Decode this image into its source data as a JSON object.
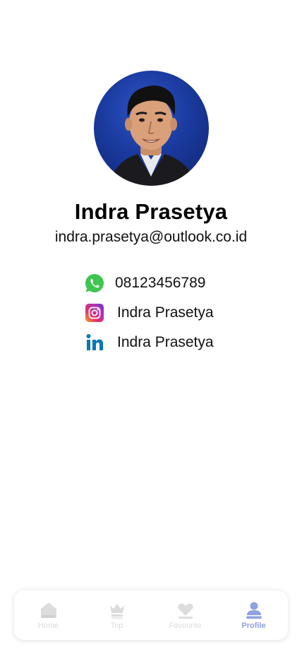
{
  "profile": {
    "name": "Indra Prasetya",
    "email": "indra.prasetya@outlook.co.id"
  },
  "contacts": {
    "whatsapp": {
      "icon": "whatsapp-icon",
      "text": "08123456789",
      "color": "#3fc551"
    },
    "instagram": {
      "icon": "instagram-icon",
      "text": "Indra Prasetya",
      "color": "#c2339b"
    },
    "linkedin": {
      "icon": "linkedin-icon",
      "text": "Indra Prasetya",
      "color": "#0a77b5"
    }
  },
  "nav": {
    "items": [
      {
        "label": "Home",
        "icon": "home-icon",
        "active": false
      },
      {
        "label": "Top",
        "icon": "crown-icon",
        "active": false
      },
      {
        "label": "Favourite",
        "icon": "heart-icon",
        "active": false
      },
      {
        "label": "Profile",
        "icon": "user-icon",
        "active": true
      }
    ],
    "active_color": "#8fa1e0",
    "inactive_color": "#dcdcdc"
  }
}
